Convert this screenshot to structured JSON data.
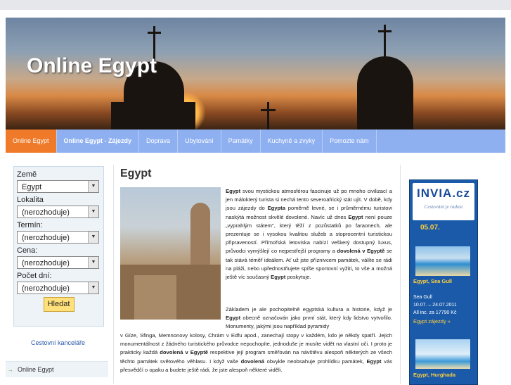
{
  "site_title": "Online Egypt",
  "nav": [
    "Online Egypt",
    "Online Egypt - Zájezdy",
    "Doprava",
    "Ubytování",
    "Památky",
    "Kuchyně a zvyky",
    "Pomozte nám"
  ],
  "search": {
    "labels": [
      "Země",
      "Lokalita",
      "Termín:",
      "Cena:",
      "Počet dní:"
    ],
    "values": [
      "Egypt",
      "(nerozhoduje)",
      "(nerozhoduje)",
      "(nerozhoduje)",
      "(nerozhoduje)"
    ],
    "button": "Hledat"
  },
  "sidebar_link": "Cestovní kanceláře",
  "sidebar_nav_item": "Online Egypt",
  "article": {
    "heading": "Egypt"
  },
  "ad": {
    "brand": "INVIA.cz",
    "tagline": "Cestování je radost",
    "date": "05.07.",
    "offer1_title": "Egypt, Sea Gull",
    "offer1_hotel": "Sea Gull",
    "offer1_dates": "10.07. – 24.07.2011",
    "offer1_price": "All inc.   za 17790 Kč",
    "offer1_link": "Egypt zájezdy »",
    "offer2_title": "Egypt, Hurghada"
  },
  "colors": {
    "nav_bg": "#8eb0f0",
    "nav_active": "#ef7a2a",
    "ad_bg": "#1a5aa8",
    "ad_accent": "#ffcf40"
  }
}
